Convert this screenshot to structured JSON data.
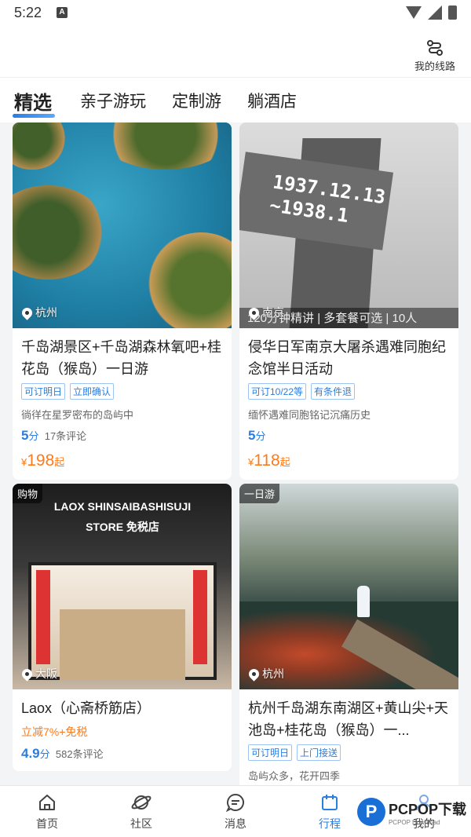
{
  "status": {
    "time": "5:22",
    "notif": "A"
  },
  "header": {
    "route_label": "我的线路"
  },
  "tabs": [
    {
      "label": "精选",
      "active": true
    },
    {
      "label": "亲子游玩",
      "active": false
    },
    {
      "label": "定制游",
      "active": false
    },
    {
      "label": "躺酒店",
      "active": false
    }
  ],
  "cards": [
    {
      "tag": "",
      "location": "杭州",
      "title": "千岛湖景区+千岛湖森林氧吧+桂花岛（猴岛）一日游",
      "badges": [
        "可订明日",
        "立即确认"
      ],
      "desc": "徜徉在星罗密布的岛屿中",
      "score": "5",
      "score_unit": "分",
      "reviews": "17条评论",
      "price_symbol": "¥",
      "price": "198",
      "price_suffix": "起"
    },
    {
      "tag": "",
      "location": "南京",
      "image_caption": "120分钟精讲 | 多套餐可选 | 10人",
      "image_text": "1937.12.13 ~1938.1",
      "title": "侵华日军南京大屠杀遇难同胞纪念馆半日活动",
      "badges": [
        "可订10/22等",
        "有条件退"
      ],
      "desc": "缅怀遇难同胞铭记沉痛历史",
      "score": "5",
      "score_unit": "分",
      "price_symbol": "¥",
      "price": "118",
      "price_suffix": "起"
    },
    {
      "tag": "购物",
      "location": "大阪",
      "image_text": "LAOX SHINSAIBASHISUJI STORE 免税店",
      "title": "Laox（心斋桥筋店）",
      "promo": "立减7%+免税",
      "score": "4.9",
      "score_unit": "分",
      "reviews": "582条评论"
    },
    {
      "tag": "一日游",
      "location": "杭州",
      "title": "杭州千岛湖东南湖区+黄山尖+天池岛+桂花岛（猴岛）一...",
      "badges": [
        "可订明日",
        "上门接送"
      ],
      "desc": "岛屿众多，花开四季"
    }
  ],
  "nav": [
    {
      "label": "首页",
      "icon": "home-icon"
    },
    {
      "label": "社区",
      "icon": "planet-icon"
    },
    {
      "label": "消息",
      "icon": "message-icon"
    },
    {
      "label": "行程",
      "icon": "calendar-icon",
      "active": true
    },
    {
      "label": "我的",
      "icon": "user-icon"
    }
  ],
  "watermark": {
    "logo": "P",
    "brand": "PCPOP下载",
    "sub": "PCPOP Download"
  },
  "colors": {
    "accent": "#2a7de1",
    "price": "#ff7a1a"
  }
}
